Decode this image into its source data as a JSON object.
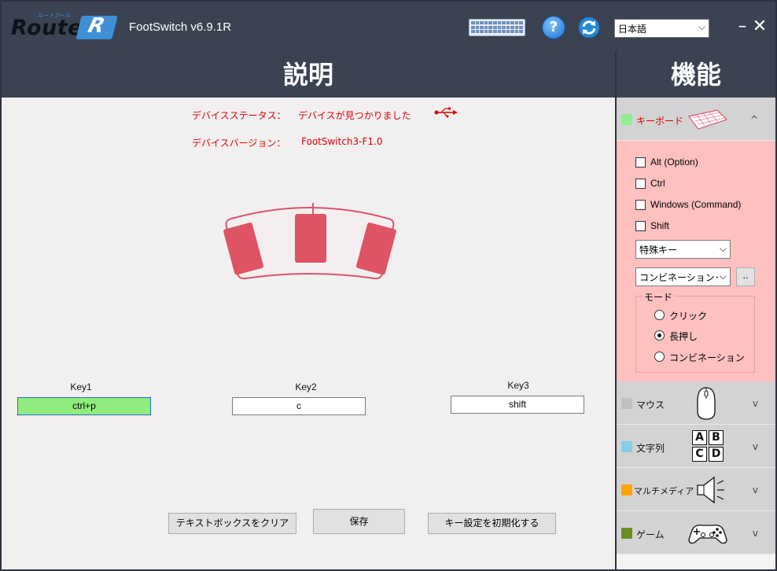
{
  "app": {
    "logo_text": "Route",
    "logo_mark": "R",
    "title": "FootSwitch v6.9.1R",
    "language": {
      "selected": "日本語"
    },
    "icons": {
      "keyboard": "keyboard-icon",
      "help": "help-icon",
      "refresh": "refresh-icon"
    }
  },
  "left": {
    "header": "説明",
    "device_status": {
      "label": "デバイスステータス：",
      "value": "デバイスが見つかりました"
    },
    "device_version": {
      "label": "デバイスバージョン：",
      "value": "FootSwitch3-F1.0"
    },
    "keys": [
      {
        "label": "Key1",
        "value": "ctrl+p"
      },
      {
        "label": "Key2",
        "value": "c"
      },
      {
        "label": "Key3",
        "value": "shift"
      }
    ],
    "buttons": {
      "clear": "テキストボックスをクリア",
      "save": "保存",
      "reset": "キー設定を初期化する"
    }
  },
  "right": {
    "header": "機能",
    "keyboard": {
      "label": "キーボード",
      "color": "#90ee90",
      "expanded": true,
      "modifiers": [
        {
          "label": "Alt (Option)",
          "checked": false
        },
        {
          "label": "Ctrl",
          "checked": false
        },
        {
          "label": "Windows (Command)",
          "checked": false
        },
        {
          "label": "Shift",
          "checked": false
        }
      ],
      "special_key_select": "特殊キー",
      "combination_select": "コンビネーション･",
      "browse_button": "..",
      "mode": {
        "title": "モード",
        "options": [
          {
            "label": "クリック",
            "selected": false
          },
          {
            "label": "長押し",
            "selected": true
          },
          {
            "label": "コンビネーション",
            "selected": false
          }
        ]
      }
    },
    "sections": [
      {
        "label": "マウス",
        "color": "#c0c0c0"
      },
      {
        "label": "文字列",
        "color": "#87ceeb",
        "letters": [
          "A",
          "B",
          "C",
          "D"
        ]
      },
      {
        "label": "マルチメディア",
        "color": "#ffa500"
      },
      {
        "label": "ゲーム",
        "color": "#6b8e23"
      }
    ]
  }
}
